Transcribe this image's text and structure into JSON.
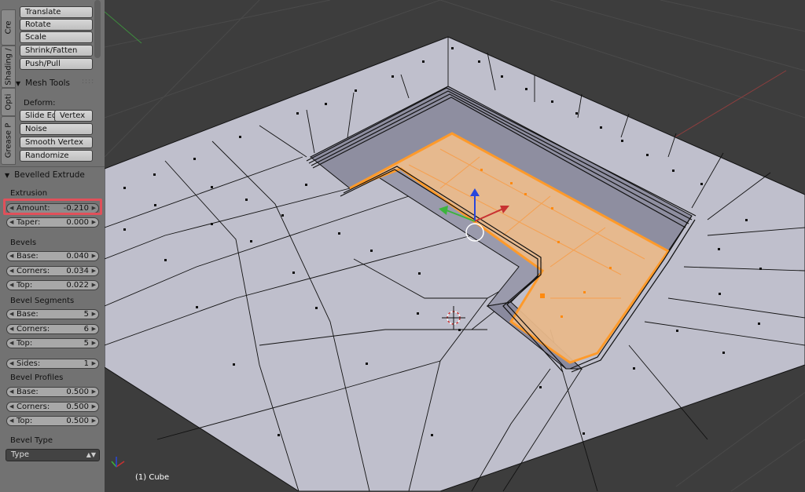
{
  "tabs": [
    "Cre",
    "Shading /",
    "Opti",
    "Grease P"
  ],
  "transform_buttons": [
    "Translate",
    "Rotate",
    "Scale",
    "Shrink/Fatten",
    "Push/Pull"
  ],
  "mesh_tools": {
    "header": "Mesh Tools",
    "deform_label": "Deform:",
    "slide_edge": "Slide Ed",
    "vertex": "Vertex",
    "noise": "Noise",
    "smooth_vertex": "Smooth Vertex",
    "randomize": "Randomize"
  },
  "operator": {
    "header": "Bevelled Extrude",
    "extrusion": {
      "label": "Extrusion",
      "amount": {
        "label": "Amount:",
        "value": "-0.210"
      },
      "taper": {
        "label": "Taper:",
        "value": "0.000"
      }
    },
    "bevels": {
      "label": "Bevels",
      "base": {
        "label": "Base:",
        "value": "0.040"
      },
      "corners": {
        "label": "Corners:",
        "value": "0.034"
      },
      "top": {
        "label": "Top:",
        "value": "0.022"
      }
    },
    "bevel_segments": {
      "label": "Bevel Segments",
      "base": {
        "label": "Base:",
        "value": "5"
      },
      "corners": {
        "label": "Corners:",
        "value": "6"
      },
      "top": {
        "label": "Top:",
        "value": "5"
      },
      "sides": {
        "label": "Sides:",
        "value": "1"
      }
    },
    "bevel_profiles": {
      "label": "Bevel Profiles",
      "base": {
        "label": "Base:",
        "value": "0.500"
      },
      "corners": {
        "label": "Corners:",
        "value": "0.500"
      },
      "top": {
        "label": "Top:",
        "value": "0.500"
      }
    },
    "bevel_type": {
      "label": "Bevel Type",
      "value": "Type"
    }
  },
  "viewport": {
    "object_label": "(1) Cube",
    "colors": {
      "background": "#3d3d3d",
      "mesh_face": "#bcbcc8",
      "selected_face": "#e8b88a",
      "selected_edge": "#ff9a2a",
      "x_axis": "#c83232",
      "y_axis": "#3cb43c",
      "z_axis": "#2846dc"
    }
  }
}
